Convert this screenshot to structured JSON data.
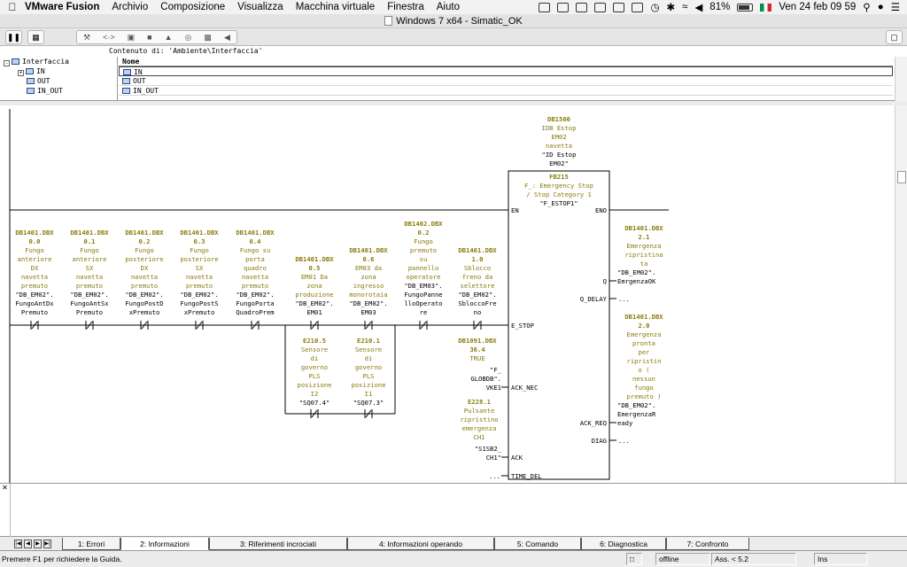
{
  "menubar": {
    "app": "VMware Fusion",
    "items": [
      "Archivio",
      "Composizione",
      "Visualizza",
      "Macchina virtuale",
      "Finestra",
      "Aiuto"
    ],
    "battery": "81%",
    "datetime": "Ven 24 feb  09 59"
  },
  "window": {
    "title": "Windows 7 x64 - Simatic_OK"
  },
  "interface": {
    "content_label": "Contenuto di: 'Ambiente\\Interfaccia'",
    "tree_root": "Interfaccia",
    "tree_items": [
      "IN",
      "OUT",
      "IN_OUT"
    ],
    "column_header": "Nome",
    "rows": [
      "IN",
      "OUT",
      "IN_OUT"
    ]
  },
  "ladder": {
    "idb": {
      "address": "DB1500",
      "lines": [
        "IDB Estop",
        "EM02",
        "navetta"
      ],
      "symbol": [
        "\"ID Estop",
        "EM02\""
      ]
    },
    "fb": {
      "name": "FB215",
      "title": [
        "F_: Emergency Stop",
        "/ Stop Category 1"
      ],
      "symbol": "\"F_ESTOP1\"",
      "en": "EN",
      "eno": "ENO",
      "pins_in": [
        "E_STOP",
        "ACK_NEC",
        "ACK",
        "TIME_DEL"
      ],
      "pins_out": [
        "Q",
        "Q_DELAY",
        "ACK_REQ",
        "DIAG"
      ]
    },
    "contacts": [
      {
        "addr": "DB1401.DBX",
        "bit": "0.0",
        "comment": [
          "Fungo",
          "anteriore",
          "DX",
          "navetta",
          "premuto"
        ],
        "symbol": [
          "\"DB_EM02\".",
          "FungoAntDx",
          "Premuto"
        ]
      },
      {
        "addr": "DB1401.DBX",
        "bit": "0.1",
        "comment": [
          "Fungo",
          "anteriore",
          "SX",
          "navetta",
          "premuto"
        ],
        "symbol": [
          "\"DB_EM02\".",
          "FungoAntSx",
          "Premuto"
        ]
      },
      {
        "addr": "DB1401.DBX",
        "bit": "0.2",
        "comment": [
          "Fungo",
          "posteriore",
          "DX",
          "navetta",
          "premuto"
        ],
        "symbol": [
          "\"DB_EM02\".",
          "FungoPostD",
          "xPremuto"
        ]
      },
      {
        "addr": "DB1401.DBX",
        "bit": "0.3",
        "comment": [
          "Fungo",
          "posteriore",
          "SX",
          "navetta",
          "premuto"
        ],
        "symbol": [
          "\"DB_EM02\".",
          "FungoPostS",
          "xPremuto"
        ]
      },
      {
        "addr": "DB1401.DBX",
        "bit": "0.4",
        "comment": [
          "Fungo su",
          "porta",
          "quadro",
          "navetta",
          "premuto"
        ],
        "symbol": [
          "\"DB_EM02\".",
          "FungoPorta",
          "QuadroPrem"
        ]
      },
      {
        "addr": "DB1401.DBX",
        "bit": "0.5",
        "comment": [
          "EM01 Da",
          "zona",
          "produzione"
        ],
        "symbol": [
          "\"DB_EM02\".",
          "EM01"
        ]
      },
      {
        "addr": "DB1401.DBX",
        "bit": "0.6",
        "comment": [
          "EM03 da",
          "zona",
          "ingresso",
          "monorotaia"
        ],
        "symbol": [
          "\"DB_EM02\".",
          "EM03"
        ]
      },
      {
        "addr": "DB1402.DBX",
        "bit": "0.2",
        "comment": [
          "Fungo",
          "premuto",
          "su",
          "pannello",
          "operatore"
        ],
        "symbol": [
          "\"DB_EM03\".",
          "FungoPanne",
          "lloOperato",
          "re"
        ]
      },
      {
        "addr": "DB1401.DBX",
        "bit": "1.0",
        "comment": [
          "Sblocco",
          "freno da",
          "selettore"
        ],
        "symbol": [
          "\"DB_EM02\".",
          "SbloccoFre",
          "no"
        ]
      }
    ],
    "parallel": [
      {
        "addr": "E210.5",
        "comment": [
          "Sensore",
          "di",
          "governo",
          "PLS",
          "posizione",
          "I2"
        ],
        "symbol": "\"SQ07.4\""
      },
      {
        "addr": "E210.1",
        "comment": [
          "Sensore",
          "di",
          "governo",
          "PLS",
          "posizione",
          "I1"
        ],
        "symbol": "\"SQ07.3\""
      }
    ],
    "ack_nec": {
      "addr": [
        "DB1091.DBX",
        "36.4"
      ],
      "comment": "TRUE",
      "symbol": [
        "\"F_",
        "GLOBDB\".",
        "VKE1"
      ]
    },
    "ack": {
      "addr": "E228.1",
      "comment": [
        "Pulsante",
        "ripristino",
        "emergenza",
        "CH1"
      ],
      "symbol": [
        "\"S1SB2_",
        "CH1\""
      ]
    },
    "time_del_value": "...",
    "q_out": {
      "addr": [
        "DB1401.DBX",
        "2.1"
      ],
      "comment": [
        "Emergenza",
        "ripristina",
        "ta"
      ],
      "symbol": [
        "\"DB_EM02\".",
        "EmrgenzaOK"
      ]
    },
    "q_delay_value": "...",
    "ack_req_out": {
      "addr": [
        "DB1401.DBX",
        "2.0"
      ],
      "comment": [
        "Emergenza",
        "pronta",
        "per",
        "ripristin",
        "o (",
        "nessun",
        "fungo",
        "premuto )"
      ],
      "symbol": [
        "\"DB_EM02\".",
        "EmergenzaR",
        "eady"
      ]
    },
    "diag_value": "..."
  },
  "tabs": [
    "1: Errori",
    "2: Informazioni",
    "3: Riferimenti incrociati",
    "4: Informazioni operando",
    "5: Comando",
    "6: Diagnostica",
    "7: Confronto"
  ],
  "status": {
    "help": "Premere F1 per richiedere la Guida.",
    "online": "offline",
    "abs": "Ass. < 5.2",
    "mode": "Ins"
  }
}
